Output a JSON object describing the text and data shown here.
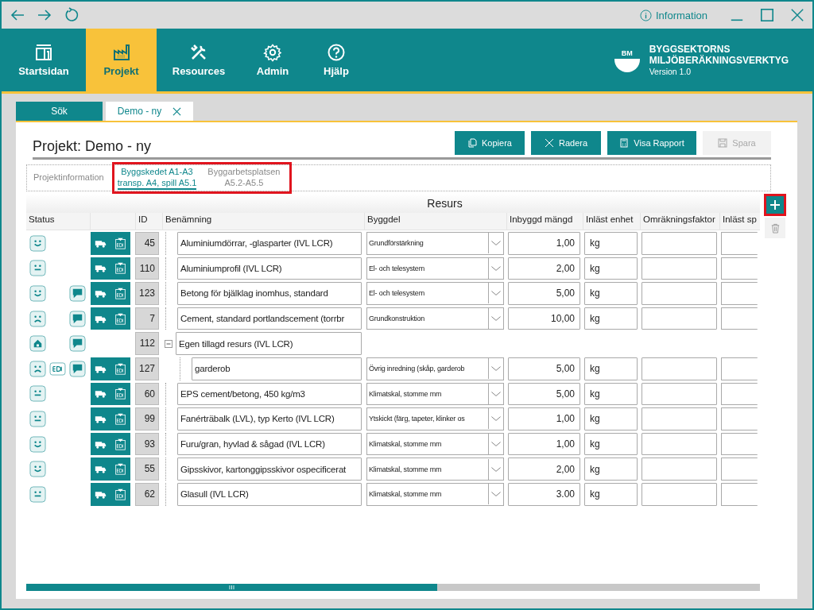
{
  "title_bar": {
    "info_label": "Information"
  },
  "nav": [
    {
      "label": "Startsidan",
      "kind": "layout",
      "selected": false
    },
    {
      "label": "Projekt",
      "kind": "factory",
      "selected": true
    },
    {
      "label": "Resources",
      "kind": "tools",
      "selected": false
    },
    {
      "label": "Admin",
      "kind": "gear",
      "selected": false
    },
    {
      "label": "Hjälp",
      "kind": "help",
      "selected": false
    }
  ],
  "brand": {
    "logo_text": "BM",
    "line1": "BYGGSEKTORNS",
    "line2": "MILJÖBERÄKNINGSVERKTYG",
    "version": "Version 1.0"
  },
  "doc_tabs": [
    {
      "label": "Sök",
      "selected": false,
      "closable": false
    },
    {
      "label": "Demo - ny",
      "selected": true,
      "closable": true
    }
  ],
  "page_title": "Projekt: Demo - ny",
  "actions": [
    {
      "label": "Kopiera",
      "kind": "copy",
      "disabled": false
    },
    {
      "label": "Radera",
      "kind": "delete",
      "disabled": false
    },
    {
      "label": "Visa Rapport",
      "kind": "report",
      "disabled": false
    },
    {
      "label": "Spara",
      "kind": "save",
      "disabled": true
    }
  ],
  "sub_tabs": {
    "highlighted": true,
    "items": [
      {
        "lines": [
          "Projektinformation"
        ],
        "selected": false
      }
    ],
    "highlighted_items": [
      {
        "lines": [
          "Byggskedet A1-A3",
          "transp. A4, spill A5.1"
        ],
        "selected": true
      },
      {
        "lines": [
          "Byggarbetsplatsen",
          "A5.2-A5.5"
        ],
        "selected": false
      }
    ]
  },
  "table": {
    "title": "Resurs",
    "add_highlighted": true,
    "columns": [
      "Status",
      "ID",
      "Benämning",
      "Byggdel",
      "Inbyggd mängd",
      "Inläst enhet",
      "Omräkningsfaktor",
      "Inläst sp"
    ],
    "rows": [
      {
        "kind": "item",
        "status": {
          "kind": "happy"
        },
        "epd": false,
        "comment": false,
        "tools": true,
        "id": "45",
        "name": "Aluminiumdörrar, -glasparter (IVL LCR)",
        "byggdel": "Grundförstärkning",
        "amount": "1,00",
        "unit": "kg"
      },
      {
        "kind": "item",
        "status": {
          "kind": "neutral"
        },
        "epd": false,
        "comment": false,
        "tools": true,
        "id": "110",
        "name": "Aluminiumprofil (IVL LCR)",
        "byggdel": "El- och telesystem",
        "amount": "2,00",
        "unit": "kg"
      },
      {
        "kind": "item",
        "status": {
          "kind": "happy"
        },
        "epd": false,
        "comment": true,
        "tools": true,
        "id": "123",
        "name": "Betong för bjälklag inomhus, standard",
        "byggdel": "El- och telesystem",
        "amount": "5,00",
        "unit": "kg"
      },
      {
        "kind": "item",
        "status": {
          "kind": "sad"
        },
        "epd": false,
        "comment": true,
        "tools": true,
        "id": "7",
        "name": "Cement, standard portlandscement (torrbr",
        "byggdel": "Grundkonstruktion",
        "amount": "10,00",
        "unit": "kg"
      },
      {
        "kind": "group",
        "status": {
          "kind": "custom"
        },
        "epd": false,
        "comment": true,
        "tools": false,
        "id": "112",
        "name": "Egen tillagd resurs (IVL LCR)",
        "expanded": true,
        "children": [
          {
            "kind": "item",
            "status": {
              "kind": "sad"
            },
            "epd": true,
            "comment": true,
            "tools": true,
            "id": "127",
            "name": "garderob",
            "byggdel": "Övrig inredning (skåp, garderob",
            "amount": "5,00",
            "unit": "kg"
          }
        ]
      },
      {
        "kind": "item",
        "status": {
          "kind": "neutral"
        },
        "epd": false,
        "comment": false,
        "tools": true,
        "id": "60",
        "name": "EPS cement/betong, 450 kg/m3",
        "byggdel": "Klimatskal, stomme mm",
        "amount": "5,00",
        "unit": "kg"
      },
      {
        "kind": "item",
        "status": {
          "kind": "neutral"
        },
        "epd": false,
        "comment": false,
        "tools": true,
        "id": "99",
        "name": "Fanérträbalk (LVL), typ Kerto (IVL LCR)",
        "byggdel": "Ytskickt (färg, tapeter, klinker os",
        "amount": "1,00",
        "unit": "kg"
      },
      {
        "kind": "item",
        "status": {
          "kind": "happy"
        },
        "epd": false,
        "comment": false,
        "tools": true,
        "id": "93",
        "name": "Furu/gran, hyvlad & sågad  (IVL LCR)",
        "byggdel": "Klimatskal, stomme mm",
        "amount": "1,00",
        "unit": "kg"
      },
      {
        "kind": "item",
        "status": {
          "kind": "happy"
        },
        "epd": false,
        "comment": false,
        "tools": true,
        "id": "55",
        "name": "Gipsskivor, kartonggipsskivor ospecificerat",
        "byggdel": "Klimatskal, stomme mm",
        "amount": "2,00",
        "unit": "kg"
      },
      {
        "kind": "item",
        "status": {
          "kind": "neutral"
        },
        "epd": false,
        "comment": false,
        "tools": true,
        "id": "62",
        "name": "Glasull (IVL LCR)",
        "byggdel": "Klimatskal, stomme mm",
        "amount": "3.00",
        "unit": "kg"
      }
    ]
  }
}
